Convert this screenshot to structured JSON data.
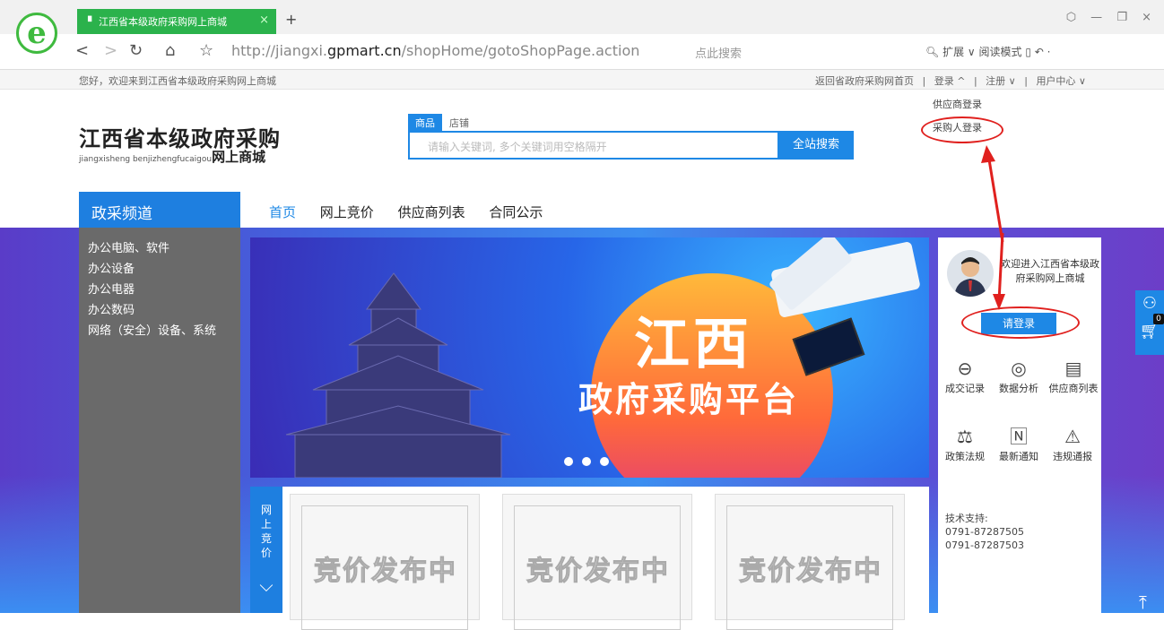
{
  "browser": {
    "tab_title": "江西省本级政府采购网上商城",
    "url_prefix": "http://jiangxi.",
    "url_domain": "gpmart.cn",
    "url_path": "/shopHome/gotoShopPage.action",
    "search_placeholder": "点此搜索",
    "tools": "扩展 ∨  阅读模式",
    "logo_glyph": "e",
    "accent": "#2bb24c"
  },
  "sitebar": {
    "welcome": "您好，欢迎来到江西省本级政府采购网上商城",
    "links": [
      "返回省政府采购网首页",
      "|",
      "登录 ^",
      "|",
      "注册 ∨",
      "|",
      "用户中心 ∨"
    ],
    "login_menu": [
      "供应商登录",
      "采购人登录"
    ]
  },
  "header": {
    "brand_title": "江西省本级政府采购",
    "brand_pinyin": "jiangxisheng benjizhengfucaigou",
    "brand_suffix": "网上商城",
    "search_tabs": [
      "商品",
      "店铺"
    ],
    "search_placeholder": "请输入关键词, 多个关键词用空格隔开",
    "search_button": "全站搜索"
  },
  "nav": {
    "channel": "政采频道",
    "items": [
      "首页",
      "网上竞价",
      "供应商列表",
      "合同公示"
    ]
  },
  "categories": [
    "办公电脑、软件",
    "办公设备",
    "办公电器",
    "办公数码",
    "网络（安全）设备、系统"
  ],
  "banner": {
    "title": "江西",
    "subtitle": "政府采购平台",
    "slides": 3
  },
  "auction": {
    "label": "网上竞价",
    "cards": [
      "竞价发布中",
      "竞价发布中",
      "竞价发布中"
    ]
  },
  "panel": {
    "welcome": "欢迎进入江西省本级政府采购网上商城",
    "login_button": "请登录",
    "quick_links": [
      {
        "label": "成交记录",
        "icon": "lock-icon"
      },
      {
        "label": "数据分析",
        "icon": "chart-icon"
      },
      {
        "label": "供应商列表",
        "icon": "list-icon"
      },
      {
        "label": "政策法规",
        "icon": "scale-icon"
      },
      {
        "label": "最新通知",
        "icon": "notice-icon"
      },
      {
        "label": "违规通报",
        "icon": "warning-icon"
      }
    ],
    "tech_title": "技术支持:",
    "phones": [
      "0791-87287505",
      "0791-87287503"
    ]
  },
  "side": {
    "cart_count": "0"
  }
}
